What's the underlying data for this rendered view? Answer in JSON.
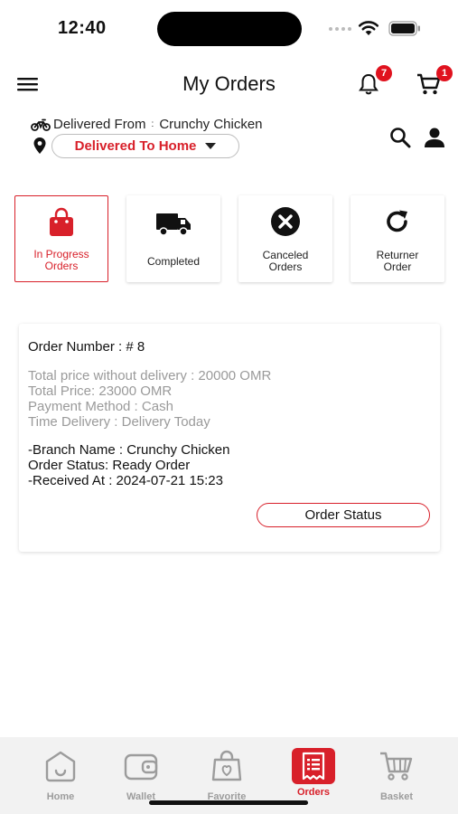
{
  "status_bar": {
    "time": "12:40"
  },
  "header": {
    "title": "My Orders",
    "notifications_count": "7",
    "cart_count": "1"
  },
  "delivery": {
    "from_label": "Delivered From",
    "separator": ":",
    "from_value": "Crunchy Chicken",
    "to_label": "Delivered To Home"
  },
  "tabs": [
    {
      "label_line1": "In Progress",
      "label_line2": "Orders",
      "icon": "shopping-bag-icon",
      "active": true
    },
    {
      "label_line1": "Completed",
      "label_line2": "",
      "icon": "truck-icon",
      "active": false
    },
    {
      "label_line1": "Canceled",
      "label_line2": "Orders",
      "icon": "cancel-icon",
      "active": false
    },
    {
      "label_line1": "Returner",
      "label_line2": "Order",
      "icon": "refresh-icon",
      "active": false
    }
  ],
  "order": {
    "number": "Order Number : # 8",
    "total_without_delivery": "Total price without delivery : 20000 OMR",
    "total_price": "Total Price: 23000 OMR",
    "payment_method": "Payment Method : Cash",
    "time_delivery": "Time Delivery : Delivery Today",
    "branch_name": "-Branch Name : Crunchy Chicken",
    "order_status": "Order Status: Ready Order",
    "received_at": "-Received At : 2024-07-21 15:23",
    "status_button": "Order Status"
  },
  "bottom_nav": [
    {
      "label": "Home",
      "icon": "home-icon",
      "active": false
    },
    {
      "label": "Wallet",
      "icon": "wallet-icon",
      "active": false
    },
    {
      "label": "Favorite",
      "icon": "favorite-bag-icon",
      "active": false
    },
    {
      "label": "Orders",
      "icon": "receipt-icon",
      "active": true
    },
    {
      "label": "Basket",
      "icon": "basket-icon",
      "active": false
    }
  ],
  "colors": {
    "accent": "#d8202a",
    "inactive": "#9c9c9c",
    "grey_text": "#9a9a9a"
  }
}
